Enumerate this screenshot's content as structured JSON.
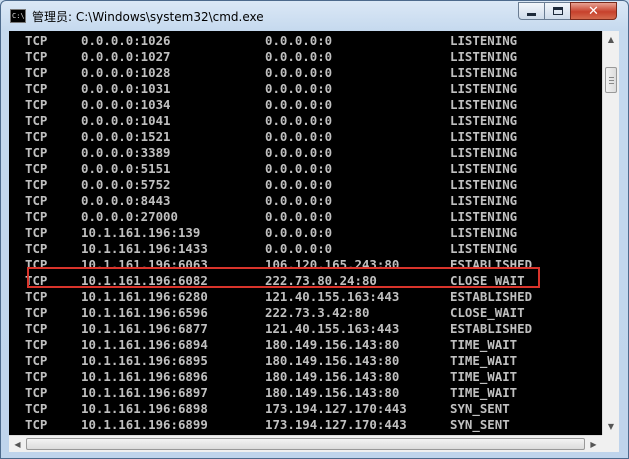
{
  "window": {
    "title": "管理员: C:\\Windows\\system32\\cmd.exe",
    "icon": "cmd-icon",
    "icon_text": "C:\\",
    "controls": [
      "minimize",
      "maximize",
      "close"
    ],
    "close_glyph": "✕"
  },
  "console": {
    "text_color": "#c0c0c0",
    "background": "#000000",
    "rows": [
      {
        "proto": "TCP",
        "local": "0.0.0.0:1026",
        "foreign": "0.0.0.0:0",
        "state": "LISTENING"
      },
      {
        "proto": "TCP",
        "local": "0.0.0.0:1027",
        "foreign": "0.0.0.0:0",
        "state": "LISTENING"
      },
      {
        "proto": "TCP",
        "local": "0.0.0.0:1028",
        "foreign": "0.0.0.0:0",
        "state": "LISTENING"
      },
      {
        "proto": "TCP",
        "local": "0.0.0.0:1031",
        "foreign": "0.0.0.0:0",
        "state": "LISTENING"
      },
      {
        "proto": "TCP",
        "local": "0.0.0.0:1034",
        "foreign": "0.0.0.0:0",
        "state": "LISTENING"
      },
      {
        "proto": "TCP",
        "local": "0.0.0.0:1041",
        "foreign": "0.0.0.0:0",
        "state": "LISTENING"
      },
      {
        "proto": "TCP",
        "local": "0.0.0.0:1521",
        "foreign": "0.0.0.0:0",
        "state": "LISTENING"
      },
      {
        "proto": "TCP",
        "local": "0.0.0.0:3389",
        "foreign": "0.0.0.0:0",
        "state": "LISTENING"
      },
      {
        "proto": "TCP",
        "local": "0.0.0.0:5151",
        "foreign": "0.0.0.0:0",
        "state": "LISTENING"
      },
      {
        "proto": "TCP",
        "local": "0.0.0.0:5752",
        "foreign": "0.0.0.0:0",
        "state": "LISTENING"
      },
      {
        "proto": "TCP",
        "local": "0.0.0.0:8443",
        "foreign": "0.0.0.0:0",
        "state": "LISTENING"
      },
      {
        "proto": "TCP",
        "local": "0.0.0.0:27000",
        "foreign": "0.0.0.0:0",
        "state": "LISTENING"
      },
      {
        "proto": "TCP",
        "local": "10.1.161.196:139",
        "foreign": "0.0.0.0:0",
        "state": "LISTENING"
      },
      {
        "proto": "TCP",
        "local": "10.1.161.196:1433",
        "foreign": "0.0.0.0:0",
        "state": "LISTENING",
        "highlighted": true
      },
      {
        "proto": "TCP",
        "local": "10.1.161.196:6063",
        "foreign": "106.120.165.243:80",
        "state": "ESTABLISHED"
      },
      {
        "proto": "TCP",
        "local": "10.1.161.196:6082",
        "foreign": "222.73.80.24:80",
        "state": "CLOSE_WAIT"
      },
      {
        "proto": "TCP",
        "local": "10.1.161.196:6280",
        "foreign": "121.40.155.163:443",
        "state": "ESTABLISHED"
      },
      {
        "proto": "TCP",
        "local": "10.1.161.196:6596",
        "foreign": "222.73.3.42:80",
        "state": "CLOSE_WAIT"
      },
      {
        "proto": "TCP",
        "local": "10.1.161.196:6877",
        "foreign": "121.40.155.163:443",
        "state": "ESTABLISHED"
      },
      {
        "proto": "TCP",
        "local": "10.1.161.196:6894",
        "foreign": "180.149.156.143:80",
        "state": "TIME_WAIT"
      },
      {
        "proto": "TCP",
        "local": "10.1.161.196:6895",
        "foreign": "180.149.156.143:80",
        "state": "TIME_WAIT"
      },
      {
        "proto": "TCP",
        "local": "10.1.161.196:6896",
        "foreign": "180.149.156.143:80",
        "state": "TIME_WAIT"
      },
      {
        "proto": "TCP",
        "local": "10.1.161.196:6897",
        "foreign": "180.149.156.143:80",
        "state": "TIME_WAIT"
      },
      {
        "proto": "TCP",
        "local": "10.1.161.196:6898",
        "foreign": "173.194.127.170:443",
        "state": "SYN_SENT"
      },
      {
        "proto": "TCP",
        "local": "10.1.161.196:6899",
        "foreign": "173.194.127.170:443",
        "state": "SYN_SENT"
      }
    ]
  },
  "highlight_color": "#d9342b",
  "scrollbars": {
    "vertical_arrows": [
      "▲",
      "▼"
    ],
    "horizontal_arrows": [
      "◀",
      "▶"
    ]
  }
}
